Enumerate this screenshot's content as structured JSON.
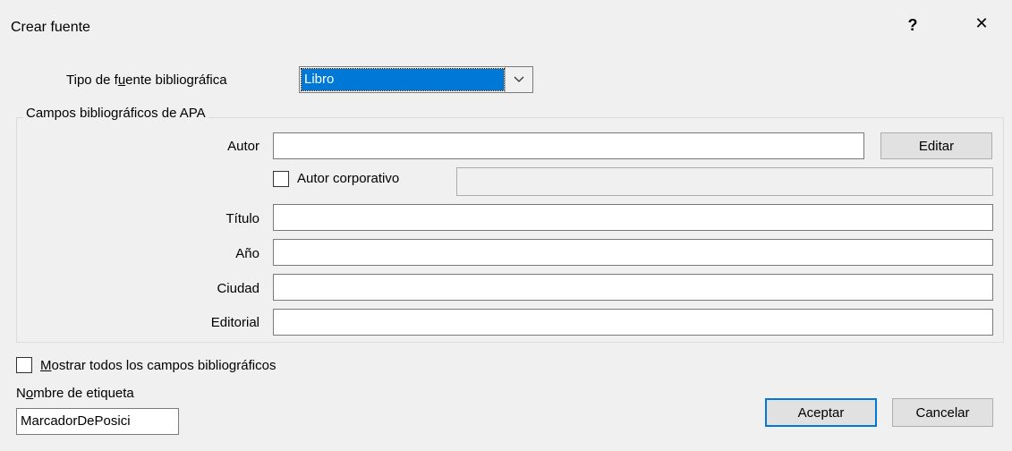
{
  "window": {
    "title": "Crear fuente",
    "help_label": "?",
    "close_label": "✕"
  },
  "source_type": {
    "label_pre": "Tipo de f",
    "label_u": "u",
    "label_post": "ente bibliográfica",
    "selected": "Libro"
  },
  "group": {
    "title": "Campos bibliográficos de APA"
  },
  "fields": {
    "author_label": "Autor",
    "edit_button": "Editar",
    "corporate_author_label": "Autor corporativo",
    "title_label": "Título",
    "year_label": "Año",
    "city_label": "Ciudad",
    "publisher_label": "Editorial",
    "author_value": "",
    "corporate_author_value": "",
    "title_value": "",
    "year_value": "",
    "city_value": "",
    "publisher_value": ""
  },
  "show_all": {
    "label_u": "M",
    "label_post": "ostrar todos los campos bibliográficos",
    "checked": false
  },
  "tag": {
    "label_pre": "N",
    "label_u": "o",
    "label_post": "mbre de etiqueta",
    "value": "MarcadorDePosici"
  },
  "buttons": {
    "ok": "Aceptar",
    "cancel": "Cancelar"
  }
}
